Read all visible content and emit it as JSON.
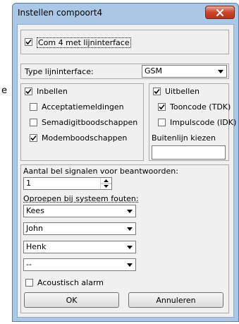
{
  "stray_text": "e",
  "window": {
    "title": "Instellen compoort4",
    "close_icon": "close-x-icon"
  },
  "com4": {
    "label": "Com 4 met lijninterface",
    "checked": true
  },
  "line_interface": {
    "label": "Type lijninterface:",
    "value": "GSM"
  },
  "inbound": {
    "header": {
      "label": "Inbellen",
      "checked": true
    },
    "items": [
      {
        "label": "Acceptatiemeldingen",
        "checked": false
      },
      {
        "label": "Semadigitboodschappen",
        "checked": false
      },
      {
        "label": "Modemboodschappen",
        "checked": true
      }
    ]
  },
  "outbound": {
    "header": {
      "label": "Uitbellen",
      "checked": true
    },
    "items": [
      {
        "label": "Tooncode (TDK)",
        "checked": true
      },
      {
        "label": "Impulscode (IDK)",
        "checked": false
      }
    ],
    "outside_line_label": "Buitenlijn kiezen",
    "outside_line_value": ""
  },
  "rings": {
    "label": "Aantal bel signalen voor beantwoorden:",
    "value": "1"
  },
  "call_on_error": {
    "label": "Oproepen bij systeem fouten:",
    "values": [
      "Kees",
      "John",
      "Henk",
      "--"
    ]
  },
  "acoustic_alarm": {
    "label": "Acoustisch alarm",
    "checked": false
  },
  "buttons": {
    "ok": "OK",
    "cancel": "Annuleren"
  }
}
